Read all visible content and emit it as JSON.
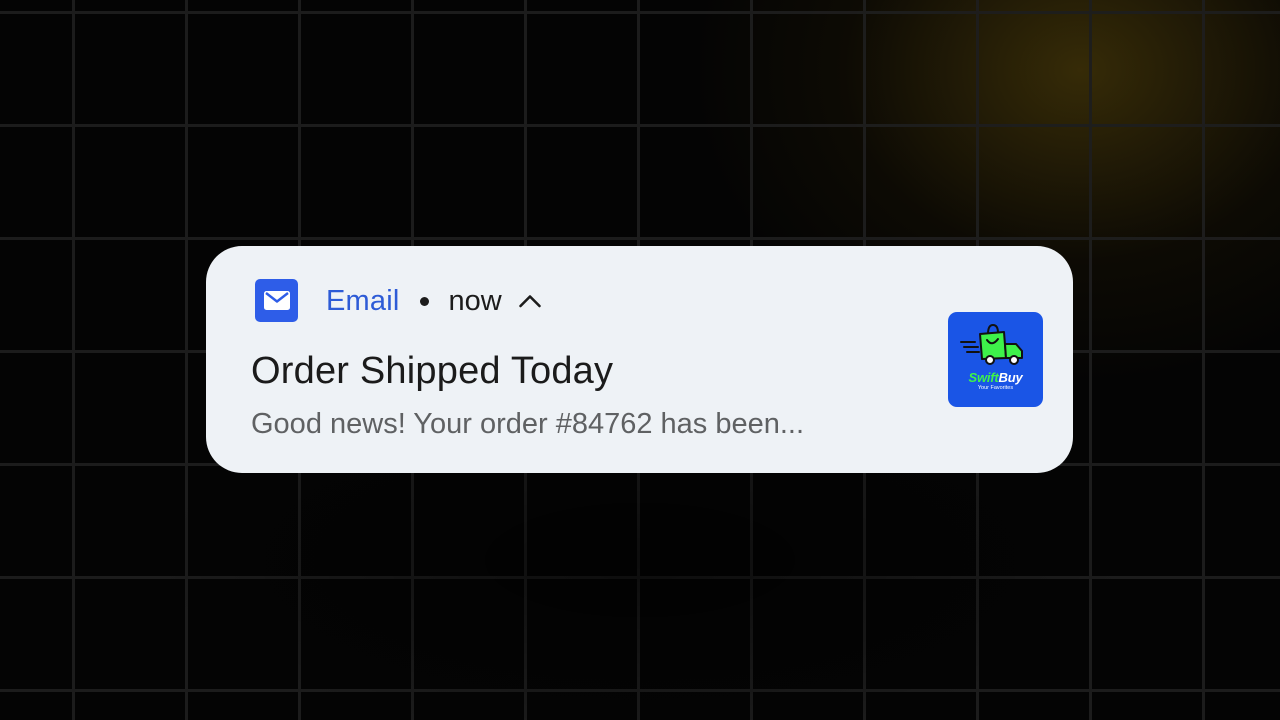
{
  "notification": {
    "app_name": "Email",
    "time": "now",
    "title": "Order Shipped Today",
    "body": "Good news! Your order #84762 has been...",
    "icons": {
      "app": "envelope-icon",
      "expand": "chevron-up-icon",
      "thumbnail": "delivery-truck-icon"
    },
    "thumbnail": {
      "brand_part1": "Swift",
      "brand_part2": "Buy",
      "tagline": "Your Favorites"
    }
  },
  "colors": {
    "accent": "#2d5bd6",
    "card_background": "#eef2f6",
    "thumbnail_background": "#1a55e6",
    "brand_green": "#3ef24a"
  }
}
